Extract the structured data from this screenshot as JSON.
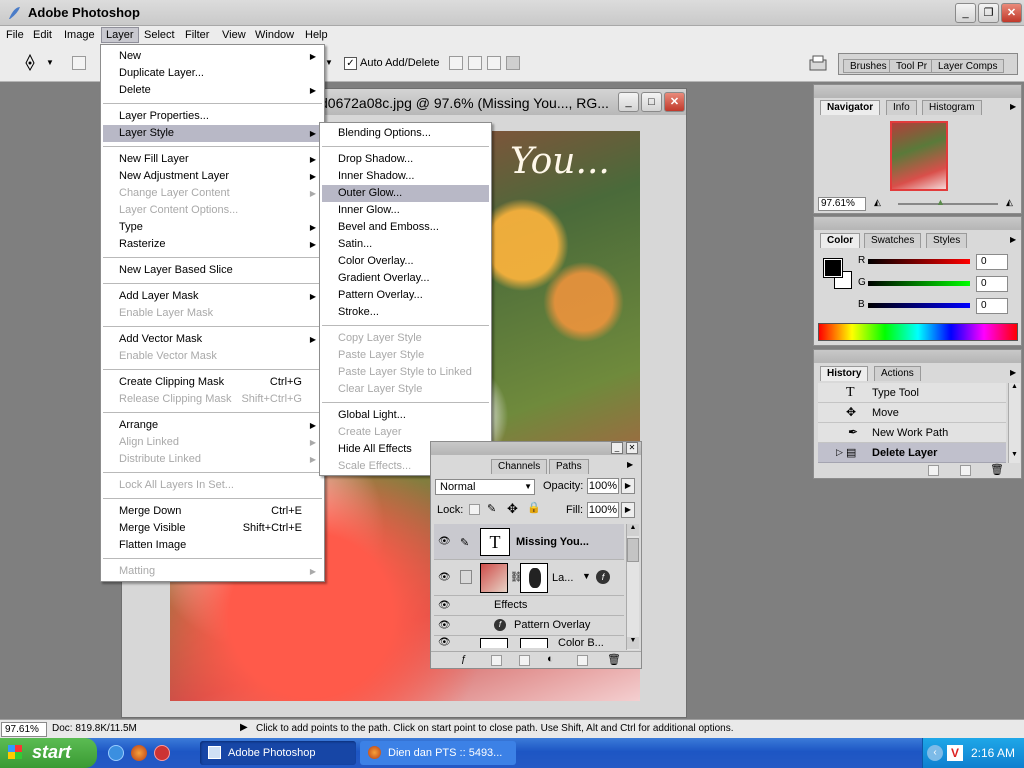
{
  "app": {
    "title": "Adobe Photoshop"
  },
  "menubar": {
    "items": [
      {
        "label": "File"
      },
      {
        "label": "Edit"
      },
      {
        "label": "Image"
      },
      {
        "label": "Layer"
      },
      {
        "label": "Select"
      },
      {
        "label": "Filter"
      },
      {
        "label": "View"
      },
      {
        "label": "Window"
      },
      {
        "label": "Help"
      }
    ]
  },
  "options": {
    "auto_add_delete": "Auto Add/Delete",
    "well_tabs": [
      "Brushes",
      "Tool Pr",
      "Layer Comps"
    ]
  },
  "document": {
    "title": "d0672a08c.jpg @ 97.6% (Missing You..., RG...",
    "canvas_text": "You..."
  },
  "layer_menu": {
    "items": [
      {
        "label": "New",
        "disabled": false,
        "submenu": true
      },
      {
        "label": "Duplicate Layer...",
        "disabled": false
      },
      {
        "label": "Delete",
        "disabled": false,
        "submenu": true
      },
      {
        "label": "Layer Properties...",
        "disabled": false
      },
      {
        "label": "Layer Style",
        "disabled": false,
        "submenu": true,
        "selected": true
      },
      {
        "label": "New Fill Layer",
        "disabled": false,
        "submenu": true
      },
      {
        "label": "New Adjustment Layer",
        "disabled": false,
        "submenu": true
      },
      {
        "label": "Change Layer Content",
        "disabled": true,
        "submenu": true
      },
      {
        "label": "Layer Content Options...",
        "disabled": true
      },
      {
        "label": "Type",
        "disabled": false,
        "submenu": true
      },
      {
        "label": "Rasterize",
        "disabled": false,
        "submenu": true
      },
      {
        "label": "New Layer Based Slice",
        "disabled": false
      },
      {
        "label": "Add Layer Mask",
        "disabled": false,
        "submenu": true
      },
      {
        "label": "Enable Layer Mask",
        "disabled": true
      },
      {
        "label": "Add Vector Mask",
        "disabled": false,
        "submenu": true
      },
      {
        "label": "Enable Vector Mask",
        "disabled": true
      },
      {
        "label": "Create Clipping Mask",
        "disabled": false,
        "shortcut": "Ctrl+G"
      },
      {
        "label": "Release Clipping Mask",
        "disabled": true,
        "shortcut": "Shift+Ctrl+G"
      },
      {
        "label": "Arrange",
        "disabled": false,
        "submenu": true
      },
      {
        "label": "Align Linked",
        "disabled": true,
        "submenu": true
      },
      {
        "label": "Distribute Linked",
        "disabled": true,
        "submenu": true
      },
      {
        "label": "Lock All Layers In Set...",
        "disabled": true
      },
      {
        "label": "Merge Down",
        "disabled": false,
        "shortcut": "Ctrl+E"
      },
      {
        "label": "Merge Visible",
        "disabled": false,
        "shortcut": "Shift+Ctrl+E"
      },
      {
        "label": "Flatten Image",
        "disabled": false
      },
      {
        "label": "Matting",
        "disabled": true,
        "submenu": true
      }
    ]
  },
  "style_menu": {
    "items": [
      {
        "label": "Blending Options...",
        "disabled": false
      },
      {
        "label": "Drop Shadow...",
        "disabled": false
      },
      {
        "label": "Inner Shadow...",
        "disabled": false
      },
      {
        "label": "Outer Glow...",
        "disabled": false,
        "selected": true
      },
      {
        "label": "Inner Glow...",
        "disabled": false
      },
      {
        "label": "Bevel and Emboss...",
        "disabled": false
      },
      {
        "label": "Satin...",
        "disabled": false
      },
      {
        "label": "Color Overlay...",
        "disabled": false
      },
      {
        "label": "Gradient Overlay...",
        "disabled": false
      },
      {
        "label": "Pattern Overlay...",
        "disabled": false
      },
      {
        "label": "Stroke...",
        "disabled": false
      },
      {
        "label": "Copy Layer Style",
        "disabled": true
      },
      {
        "label": "Paste Layer Style",
        "disabled": true
      },
      {
        "label": "Paste Layer Style to Linked",
        "disabled": true
      },
      {
        "label": "Clear Layer Style",
        "disabled": true
      },
      {
        "label": "Global Light...",
        "disabled": false
      },
      {
        "label": "Create Layer",
        "disabled": true
      },
      {
        "label": "Hide All Effects",
        "disabled": false
      },
      {
        "label": "Scale Effects...",
        "disabled": true
      }
    ]
  },
  "navigator": {
    "tabs": [
      "Navigator",
      "Info",
      "Histogram"
    ],
    "zoom": "97.61%"
  },
  "color": {
    "tabs": [
      "Color",
      "Swatches",
      "Styles"
    ],
    "r_label": "R",
    "g_label": "G",
    "b_label": "B",
    "r": "0",
    "g": "0",
    "b": "0"
  },
  "history": {
    "tabs": [
      "History",
      "Actions"
    ],
    "items": [
      {
        "label": "Type Tool"
      },
      {
        "label": "Move"
      },
      {
        "label": "New Work Path"
      },
      {
        "label": "Delete Layer",
        "current": true
      }
    ]
  },
  "layers": {
    "tabs": [
      "Channels",
      "Paths"
    ],
    "blend_mode": "Normal",
    "opacity_label": "Opacity:",
    "opacity": "100%",
    "lock_label": "Lock:",
    "fill_label": "Fill:",
    "fill": "100%",
    "rows": [
      {
        "label": "Missing You...",
        "thumb": "T"
      },
      {
        "label": "La..."
      },
      {
        "label": "Effects"
      },
      {
        "label": "Pattern Overlay"
      },
      {
        "label": "Color B..."
      }
    ]
  },
  "status": {
    "zoom": "97.61%",
    "doc": "Doc: 819.8K/11.5M",
    "hint": "Click to add points to the path.  Click on start point to close path.  Use Shift, Alt and Ctrl for additional options."
  },
  "taskbar": {
    "start": "start",
    "tasks": [
      "Adobe Photoshop",
      "Dien dan PTS :: 5493..."
    ],
    "clock": "2:16 AM"
  }
}
